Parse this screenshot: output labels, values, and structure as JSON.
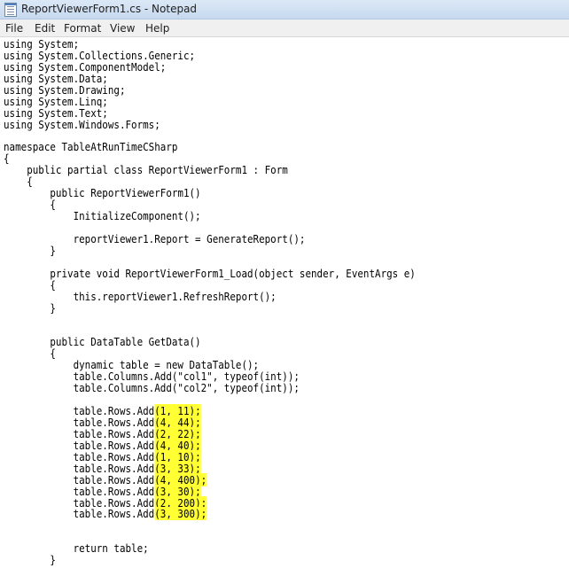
{
  "window": {
    "title": "ReportViewerForm1.cs - Notepad"
  },
  "menu": {
    "items": [
      "File",
      "Edit",
      "Format",
      "View",
      "Help"
    ]
  },
  "highlight_color": "#ffff33",
  "code_lines": [
    "using System;",
    "using System.Collections.Generic;",
    "using System.ComponentModel;",
    "using System.Data;",
    "using System.Drawing;",
    "using System.Linq;",
    "using System.Text;",
    "using System.Windows.Forms;",
    "",
    "namespace TableAtRunTimeCSharp",
    "{",
    "    public partial class ReportViewerForm1 : Form",
    "    {",
    "        public ReportViewerForm1()",
    "        {",
    "            InitializeComponent();",
    "",
    "            reportViewer1.Report = GenerateReport();",
    "        }",
    "",
    "        private void ReportViewerForm1_Load(object sender, EventArgs e)",
    "        {",
    "            this.reportViewer1.RefreshReport();",
    "        }",
    "",
    "",
    "        public DataTable GetData()",
    "        {",
    "            dynamic table = new DataTable();",
    "            table.Columns.Add(\"col1\", typeof(int));",
    "            table.Columns.Add(\"col2\", typeof(int));",
    "",
    "            table.Rows.Add(1, 11);",
    "            table.Rows.Add(4, 44);",
    "            table.Rows.Add(2, 22);",
    "            table.Rows.Add(4, 40);",
    "            table.Rows.Add(1, 10);",
    "            table.Rows.Add(3, 33);",
    "            table.Rows.Add(4, 400);",
    "            table.Rows.Add(3, 30);",
    "            table.Rows.Add(2, 200);",
    "            table.Rows.Add(3, 300);",
    "",
    "",
    "            return table;",
    "        }"
  ],
  "highlighted_rows": {
    "prefix": "            table.Rows.Add",
    "first_line_index": 32,
    "args": [
      "(1, 11);",
      "(4, 44);",
      "(2, 22);",
      "(4, 40);",
      "(1, 10);",
      "(3, 33);",
      "(4, 400);",
      "(3, 30);",
      "(2, 200);",
      "(3, 300);"
    ]
  }
}
